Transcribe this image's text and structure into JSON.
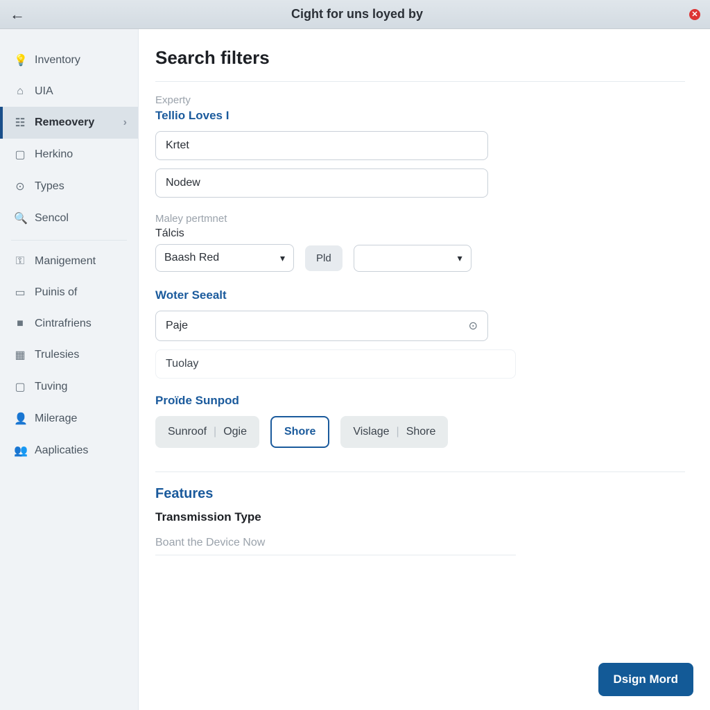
{
  "titlebar": {
    "back_glyph": "←",
    "title": "Cight for uns loyed by",
    "close_glyph": "✕"
  },
  "sidebar": {
    "items": [
      {
        "icon": "💡",
        "label": "Inventory",
        "name": "sidebar-item-inventory"
      },
      {
        "icon": "⌂",
        "label": "UIA",
        "name": "sidebar-item-uia"
      },
      {
        "icon": "☷",
        "label": "Remeovery",
        "name": "sidebar-item-remeovery",
        "selected": true,
        "chevron": "›"
      },
      {
        "icon": "▢",
        "label": "Herkino",
        "name": "sidebar-item-herkino"
      },
      {
        "icon": "⊙",
        "label": "Types",
        "name": "sidebar-item-types"
      },
      {
        "icon": "🔍",
        "label": "Sencol",
        "name": "sidebar-item-sencol"
      }
    ],
    "items2": [
      {
        "icon": "⚿",
        "label": "Manigement",
        "name": "sidebar-item-manigement"
      },
      {
        "icon": "▭",
        "label": "Puinis of",
        "name": "sidebar-item-puinis"
      },
      {
        "icon": "■",
        "label": "Cintrafriens",
        "name": "sidebar-item-cintrafriens"
      },
      {
        "icon": "▦",
        "label": "Trulesies",
        "name": "sidebar-item-trulesies"
      },
      {
        "icon": "▢",
        "label": "Tuving",
        "name": "sidebar-item-tuving"
      },
      {
        "icon": "👤",
        "label": "Milerage",
        "name": "sidebar-item-milerage"
      },
      {
        "icon": "👥",
        "label": "Aaplicaties",
        "name": "sidebar-item-aaplicaties"
      }
    ]
  },
  "main": {
    "page_title": "Search filters",
    "group1": {
      "note": "Experty",
      "title": "Tellio Loves I",
      "field1_value": "Krtet",
      "field2_value": "Nodew"
    },
    "group2": {
      "note": "Maley pertmnet",
      "label": "Tálcis",
      "select1_value": "Baash Red",
      "pill_label": "Pld",
      "select2_value": ""
    },
    "group3": {
      "title": "Woter Seealt",
      "field_value": "Paje",
      "trailing_glyph": "⊙",
      "ghost_value": "Tuolay"
    },
    "group4": {
      "title": "Proïde Sunpod",
      "chips": [
        {
          "a": "Sunroof",
          "b": "Ogie"
        },
        {
          "a": "Shore",
          "selected": true
        },
        {
          "a": "Vislage",
          "b": "Shore"
        }
      ]
    },
    "features": {
      "title": "Features",
      "sub": "Transmission Type",
      "placeholder": "Boant the Device Now"
    },
    "primary_button": "Dsign Mord"
  }
}
